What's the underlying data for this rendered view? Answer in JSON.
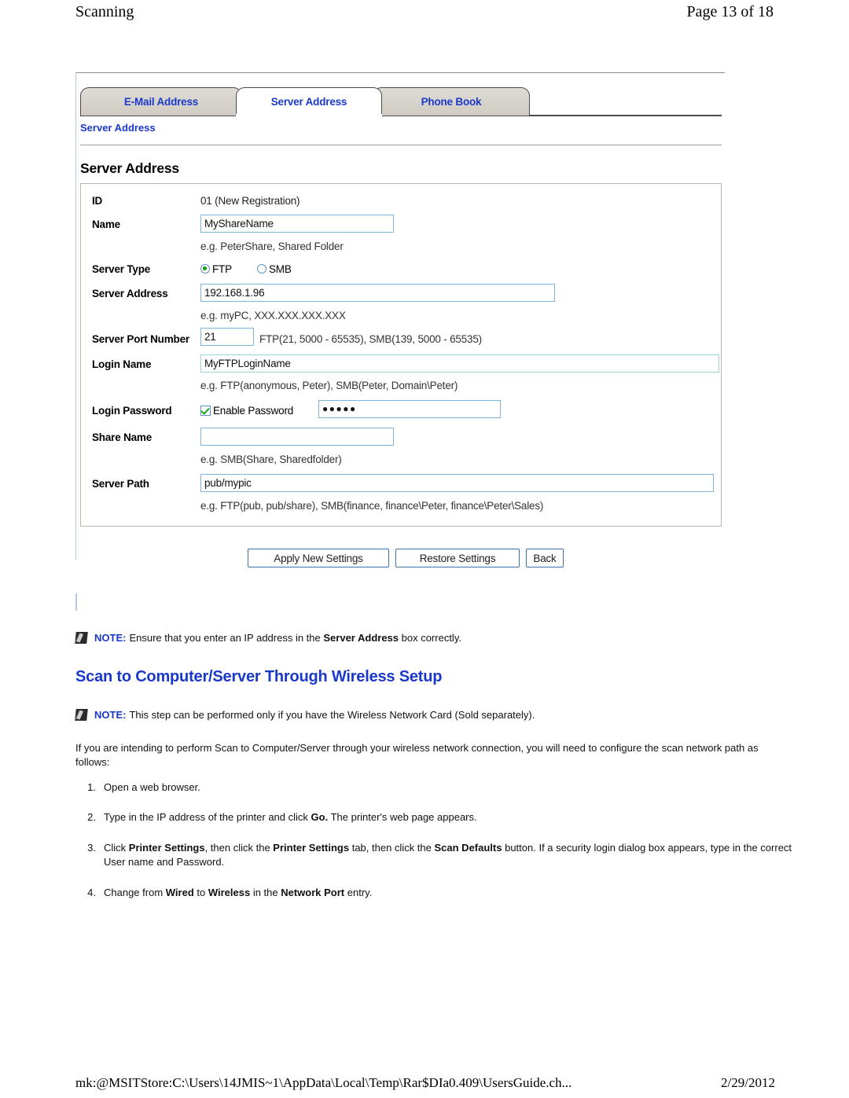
{
  "header": {
    "left_title": "Scanning",
    "page_indicator": "Page 13 of 18"
  },
  "screenshot": {
    "tabs": [
      {
        "label": "E-Mail Address",
        "active": false
      },
      {
        "label": "Server Address",
        "active": true
      },
      {
        "label": "Phone Book",
        "active": false
      }
    ],
    "breadcrumb": "Server Address",
    "section_title": "Server Address",
    "fields": {
      "id_label": "ID",
      "id_value": "01 (New Registration)",
      "name_label": "Name",
      "name_value": "MyShareName",
      "name_hint": "e.g. PeterShare, Shared Folder",
      "server_type_label": "Server Type",
      "server_type_options": [
        "FTP",
        "SMB"
      ],
      "server_type_selected": "FTP",
      "server_address_label": "Server Address",
      "server_address_value": "192.168.1.96",
      "server_address_hint": "e.g. myPC, XXX.XXX.XXX.XXX",
      "port_label": "Server Port Number",
      "port_value": "21",
      "port_hint": "FTP(21, 5000 - 65535), SMB(139, 5000 - 65535)",
      "login_name_label": "Login Name",
      "login_name_value": "MyFTPLoginName",
      "login_name_hint": "e.g. FTP(anonymous, Peter), SMB(Peter, Domain\\Peter)",
      "login_password_label": "Login Password",
      "enable_password_label": "Enable Password",
      "enable_password_checked": true,
      "password_value": "●●●●●",
      "share_name_label": "Share Name",
      "share_name_value": "",
      "share_name_hint": "e.g. SMB(Share, Sharedfolder)",
      "server_path_label": "Server Path",
      "server_path_value": "pub/mypic",
      "server_path_hint": "e.g. FTP(pub, pub/share), SMB(finance, finance\\Peter, finance\\Peter\\Sales)"
    },
    "buttons": [
      {
        "label": "Apply New Settings"
      },
      {
        "label": "Restore Settings"
      },
      {
        "label": "Back"
      }
    ]
  },
  "notes": {
    "label": "NOTE:",
    "note1_before": "Ensure that you enter an IP address in the ",
    "note1_bold": "Server Address",
    "note1_after": " box correctly.",
    "note2_text": "This step can be performed only if you have the Wireless Network Card (Sold separately)."
  },
  "heading": "Scan to Computer/Server Through Wireless Setup",
  "intro_paragraph": "If you are intending to perform Scan to Computer/Server through your wireless network connection, you will need to configure the scan network path as follows:",
  "steps": [
    {
      "n": "1",
      "text": "Open a web browser."
    },
    {
      "n": "2",
      "p1": "Type in the IP address of the printer and click ",
      "b1": "Go.",
      "p2": " The printer's web page appears."
    },
    {
      "n": "3",
      "p1": "Click ",
      "b1": "Printer Settings",
      "p2": ", then click the ",
      "b2": "Printer Settings",
      "p3": " tab, then click the ",
      "b3": "Scan Defaults",
      "p4": " button. If a security login dialog box appears, type in the correct User name and Password."
    },
    {
      "n": "4",
      "p1": "Change from ",
      "b1": "Wired",
      "p2": " to ",
      "b2": "Wireless",
      "p3": " in the ",
      "b3": "Network Port",
      "p4": " entry."
    }
  ],
  "footer": {
    "path": "mk:@MSITStore:C:\\Users\\14JMIS~1\\AppData\\Local\\Temp\\Rar$DIa0.409\\UsersGuide.ch...",
    "date": "2/29/2012"
  },
  "colors": {
    "link_blue": "#1a39c8",
    "tab_gray": "#d4d0c8",
    "field_border": "#7eb4d8",
    "accent_green": "#19a319"
  }
}
